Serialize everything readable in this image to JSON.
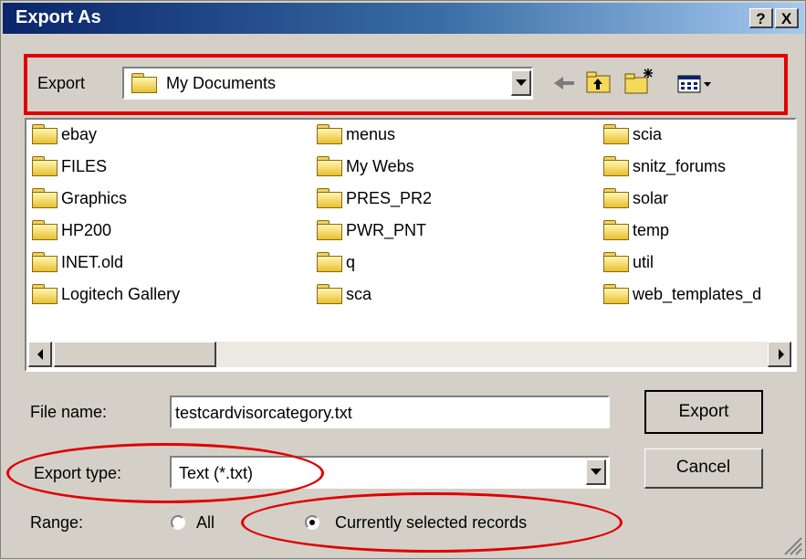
{
  "window": {
    "title": "Export As",
    "help_label": "?",
    "close_label": "X"
  },
  "toolbar": {
    "label": "Export",
    "location": "My Documents",
    "icons": [
      "back-arrow-icon",
      "up-folder-icon",
      "new-folder-icon",
      "view-menu-icon"
    ]
  },
  "files": {
    "col1": [
      "ebay",
      "FILES",
      "Graphics",
      "HP200",
      "INET.old",
      "Logitech Gallery"
    ],
    "col2": [
      "menus",
      "My Webs",
      "PRES_PR2",
      "PWR_PNT",
      "q",
      "sca"
    ],
    "col3": [
      "scia",
      "snitz_forums",
      "solar",
      "temp",
      "util",
      "web_templates_d"
    ]
  },
  "form": {
    "filename_label": "File name:",
    "filename_value": "testcardvisorcategory.txt",
    "type_label": "Export type:",
    "type_value": "Text (*.txt)",
    "range_label": "Range:",
    "range_all": "All",
    "range_selected": "Currently selected records",
    "range_selected_checked": true
  },
  "buttons": {
    "export": "Export",
    "cancel": "Cancel"
  },
  "annotation_color": "#e00000"
}
